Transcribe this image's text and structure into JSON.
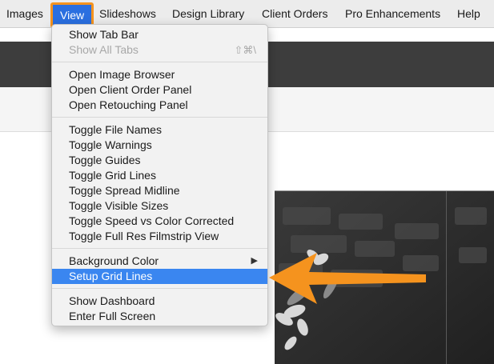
{
  "menubar": {
    "items": [
      "Images",
      "View",
      "Slideshows",
      "Design Library",
      "Client Orders",
      "Pro Enhancements",
      "Help"
    ]
  },
  "view_menu": {
    "show_tab_bar": "Show Tab Bar",
    "show_all_tabs": "Show All Tabs",
    "show_all_tabs_shortcut": "⇧⌘\\",
    "open_image_browser": "Open Image Browser",
    "open_client_order_panel": "Open Client Order Panel",
    "open_retouching_panel": "Open Retouching Panel",
    "toggle_file_names": "Toggle File Names",
    "toggle_warnings": "Toggle Warnings",
    "toggle_guides": "Toggle Guides",
    "toggle_grid_lines": "Toggle Grid Lines",
    "toggle_spread_midline": "Toggle Spread Midline",
    "toggle_visible_sizes": "Toggle Visible Sizes",
    "toggle_speed_vs_color": "Toggle Speed vs Color Corrected",
    "toggle_full_res_filmstrip": "Toggle Full Res Filmstrip View",
    "background_color": "Background Color",
    "submenu_glyph": "▶",
    "setup_grid_lines": "Setup Grid Lines",
    "show_dashboard": "Show Dashboard",
    "enter_full_screen": "Enter Full Screen"
  },
  "colors": {
    "highlight": "#3a86f0",
    "callout": "#f5931e",
    "toolbar": "#3d3d3d"
  },
  "icons": {
    "submenu": "chevron-right-icon",
    "callout": "arrow-left-icon"
  }
}
